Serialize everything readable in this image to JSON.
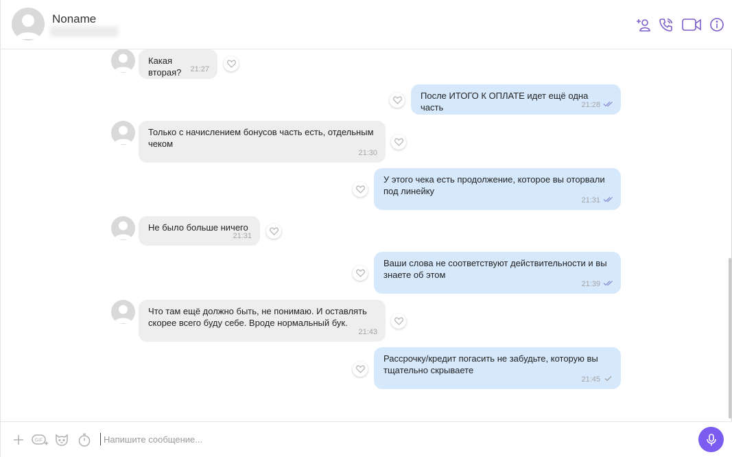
{
  "header": {
    "contact_name": "Noname",
    "icons": [
      "add-contact-icon",
      "call-icon",
      "video-call-icon",
      "info-icon"
    ]
  },
  "messages": [
    {
      "direction": "in",
      "text": "Какая вторая?",
      "time": "21:27"
    },
    {
      "direction": "out",
      "text": "После ИТОГО К ОПЛАТЕ идет ещё одна часть",
      "time": "21:28",
      "status": "read"
    },
    {
      "direction": "in",
      "text": "Только с начислением бонусов часть есть, отдельным чеком",
      "time": "21:30"
    },
    {
      "direction": "out",
      "text": "У этого чека есть продолжение, которое вы оторвали под линейку",
      "time": "21:31",
      "status": "read"
    },
    {
      "direction": "in",
      "text": "Не было больше ничего",
      "time": "21:31"
    },
    {
      "direction": "out",
      "text": "Ваши слова не соответствуют действительности и вы знаете об этом",
      "time": "21:39",
      "status": "read"
    },
    {
      "direction": "in",
      "text": "Что там ещё должно быть, не понимаю. И оставлять скорее всего буду себе. Вроде нормальный бук.",
      "time": "21:43"
    },
    {
      "direction": "out",
      "text": "Рассрочку/кредит погасить не забудьте, которую вы тщательно скрываете",
      "time": "21:45",
      "status": "sent"
    }
  ],
  "composer": {
    "placeholder": "Напишите сообщение...",
    "gif_label": "GIF",
    "icons": [
      "plus-icon",
      "gif-icon",
      "sticker-icon",
      "timer-icon",
      "microphone-icon"
    ]
  },
  "colors": {
    "accent": "#7b5cf0",
    "incoming_bubble": "#eeeeee",
    "outgoing_bubble": "#d6e8fb"
  }
}
